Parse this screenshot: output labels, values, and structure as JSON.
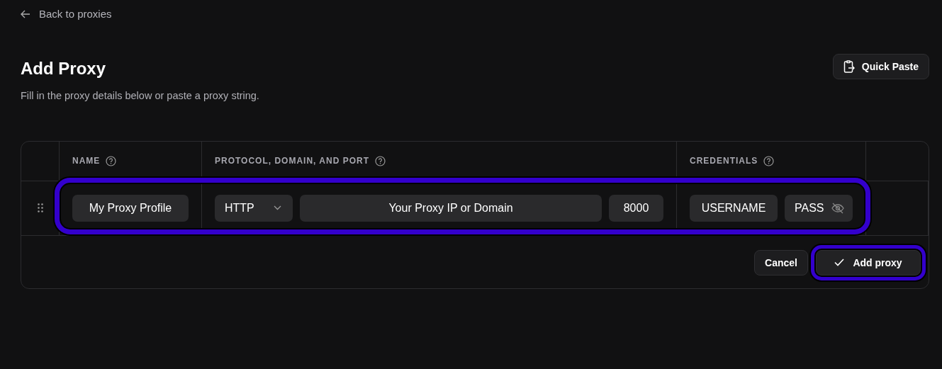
{
  "back_link": "Back to proxies",
  "title": "Add Proxy",
  "subtitle": "Fill in the proxy details below or paste a proxy string.",
  "quick_paste_button": "Quick Paste",
  "table": {
    "columns": [
      "NAME",
      "PROTOCOL, DOMAIN, AND PORT",
      "CREDENTIALS"
    ],
    "row": {
      "focused": true,
      "name": "My Proxy Profile",
      "protocol": "HTTP",
      "domain": "Your Proxy IP or Domain",
      "port": "8000",
      "username": "USERNAME",
      "password": "PASS"
    }
  },
  "buttons": [
    {
      "label": "Cancel",
      "kind": "cancel",
      "focused": false
    },
    {
      "label": "Add proxy",
      "kind": "submit",
      "focused": true
    }
  ]
}
